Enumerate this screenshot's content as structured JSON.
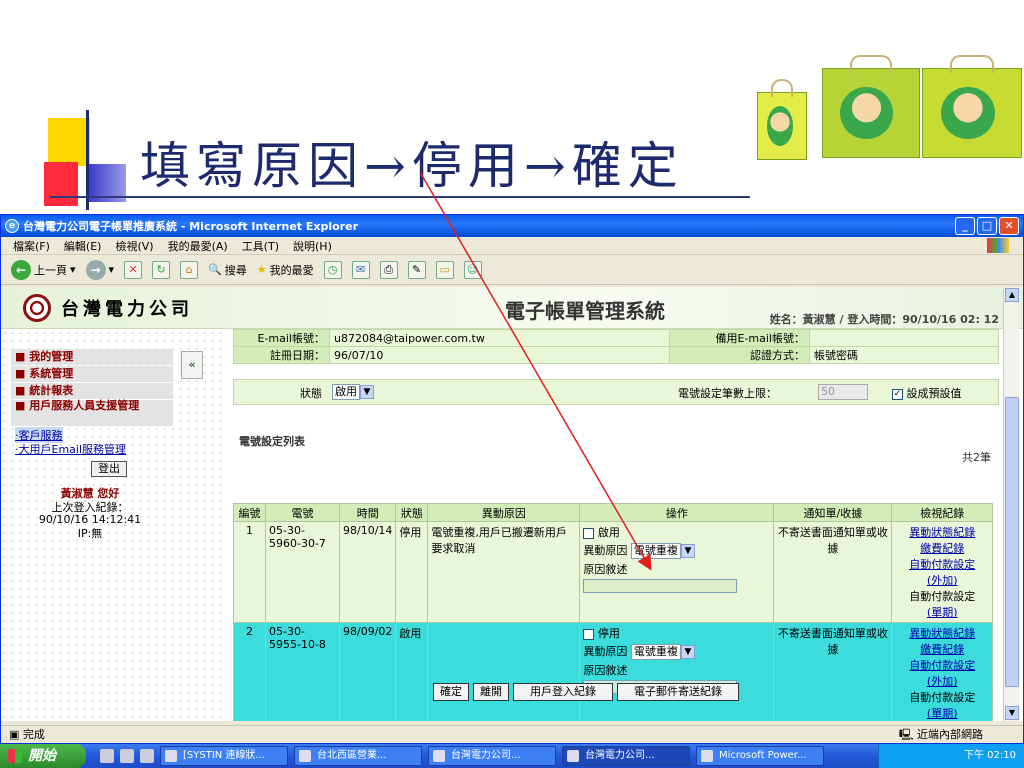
{
  "slide": {
    "title": "填寫原因→停用→確定"
  },
  "window": {
    "title": "台灣電力公司電子帳單推廣系統 - Microsoft Internet Explorer",
    "menu": [
      "檔案(F)",
      "編輯(E)",
      "檢視(V)",
      "我的最愛(A)",
      "工具(T)",
      "說明(H)"
    ],
    "toolbar": {
      "back": "上一頁",
      "search": "搜尋",
      "favorites": "我的最愛"
    }
  },
  "header": {
    "company": "台灣電力公司",
    "system": "電子帳單管理系統",
    "user_info": "姓名：黃淑慧 / 登入時間：90/10/16 02: 12"
  },
  "nav": {
    "items": [
      "我的管理",
      "系統管理",
      "統計報表",
      "用戶服務人員支援管理"
    ],
    "links": [
      "客戶服務",
      "大用戶Email服務管理"
    ],
    "logout": "登出",
    "greeting": "黃淑慧 您好",
    "last_login_label": "上次登入紀錄：",
    "last_login": "90/10/16 14:12:41",
    "ip": "IP:無"
  },
  "info": {
    "email_label": "E-mail帳號：",
    "email": "u872084@taipower.com.tw",
    "backup_email_label": "備用E-mail帳號：",
    "backup_email": "",
    "reg_date_label": "註冊日期：",
    "reg_date": "96/07/10",
    "auth_label": "認證方式：",
    "auth": "帳號密碼",
    "status_label": "狀態",
    "status_value": "啟用",
    "limit_label": "電號設定筆數上限：",
    "limit_value": "50",
    "default_label": "設成預設值"
  },
  "list": {
    "title": "電號設定列表",
    "total": "共2筆",
    "headers": [
      "編號",
      "電號",
      "時間",
      "狀態",
      "異動原因",
      "操作",
      "通知單/收據",
      "檢視紀錄"
    ],
    "rows": [
      {
        "no": "1",
        "account": "05-30-5960-30-7",
        "time": "98/10/14",
        "status": "停用",
        "reason": "電號重複,用戶已搬遷新用戶要求取消",
        "op_check": "啟用",
        "op_reason_label": "異動原因",
        "op_reason_value": "電號重複",
        "op_desc_label": "原因敘述",
        "notice": "不寄送書面通知單或收據",
        "log1": "異動狀態紀錄",
        "log2": "繳費紀錄",
        "log3": "自動付款設定",
        "log4": "(外加)",
        "log5": "自動付款設定",
        "log6": "(單期)"
      },
      {
        "no": "2",
        "account": "05-30-5955-10-8",
        "time": "98/09/02",
        "status": "啟用",
        "reason": "",
        "op_check": "停用",
        "op_reason_label": "異動原因",
        "op_reason_value": "電號重複",
        "op_desc_label": "原因敘述",
        "notice": "不寄送書面通知單或收據",
        "log1": "異動狀態紀錄",
        "log2": "繳費紀錄",
        "log3": "自動付款設定",
        "log4": "(外加)",
        "log5": "自動付款設定",
        "log6": "(單期)"
      }
    ]
  },
  "buttons": {
    "confirm": "確定",
    "leave": "離開",
    "login_log": "用戶登入紀錄",
    "email_log": "電子郵件寄送紀錄"
  },
  "status_bar": {
    "text": "完成",
    "zone": "近端內部網路"
  },
  "taskbar": {
    "start": "開始",
    "tasks": [
      "[SYSTIN 連線狀...",
      "台北西區營業...",
      "台灣電力公司...",
      "台灣電力公司...",
      "Microsoft Power..."
    ],
    "clock": "下午 02:10"
  },
  "colors": {
    "title_blue": "#1e2a6e",
    "annotation_arrow": "#e02020",
    "row_highlight": "#3cdcdc"
  }
}
